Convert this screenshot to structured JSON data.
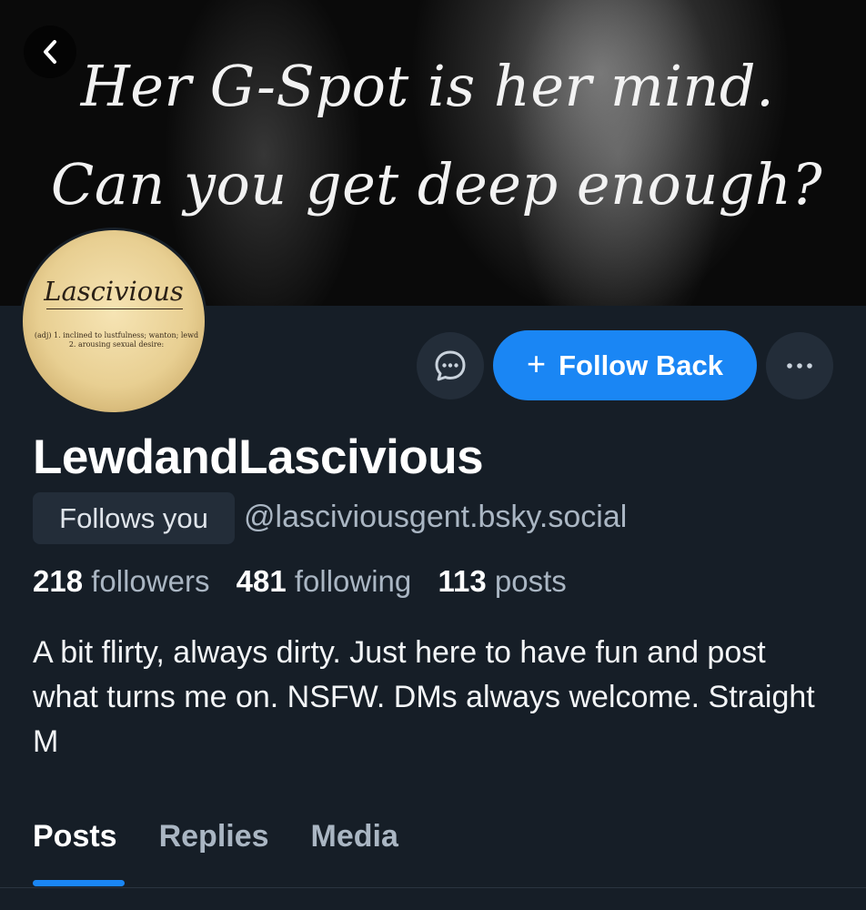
{
  "banner": {
    "line1": "Her G-Spot is her mind.",
    "line2": "Can you get deep enough?"
  },
  "avatar": {
    "title": "Lascivious",
    "def1": "(adj) 1. inclined to lustfulness; wanton; lewd",
    "def2": "2. arousing sexual desire:"
  },
  "actions": {
    "message_icon": "chat-bubble-icon",
    "follow_label": "Follow Back",
    "follow_plus": "+",
    "more_icon": "ellipsis-icon"
  },
  "profile": {
    "display_name": "LewdandLascivious",
    "follows_you": "Follows you",
    "handle": "@lasciviousgent.bsky.social",
    "followers_count": "218",
    "followers_label": "followers",
    "following_count": "481",
    "following_label": "following",
    "posts_count": "113",
    "posts_label": "posts",
    "bio": "A bit flirty, always dirty. Just here to have fun and post what turns me on. NSFW. DMs always welcome. Straight M"
  },
  "tabs": [
    {
      "label": "Posts",
      "active": true
    },
    {
      "label": "Replies",
      "active": false
    },
    {
      "label": "Media",
      "active": false
    }
  ],
  "colors": {
    "background": "#161e27",
    "accent": "#1a86f4",
    "muted_text": "#aab6c3",
    "button_bg": "#232d39"
  }
}
